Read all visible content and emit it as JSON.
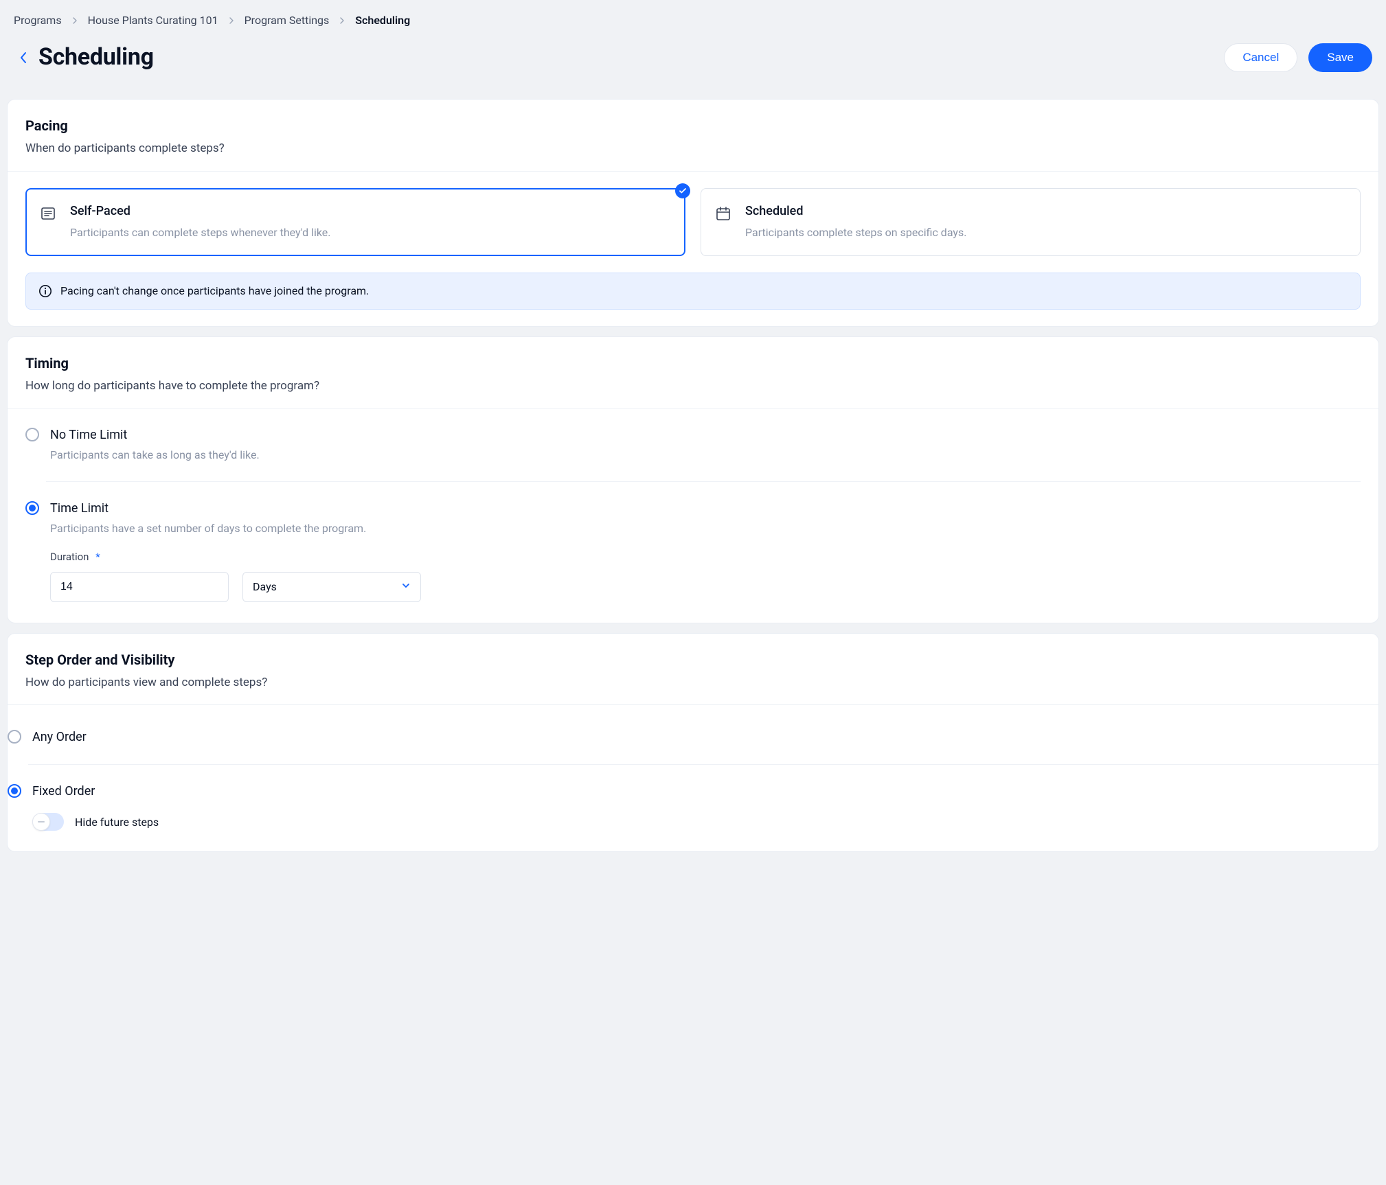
{
  "breadcrumbs": {
    "items": [
      {
        "label": "Programs"
      },
      {
        "label": "House Plants Curating 101"
      },
      {
        "label": "Program Settings"
      },
      {
        "label": "Scheduling"
      }
    ]
  },
  "header": {
    "title": "Scheduling",
    "cancel": "Cancel",
    "save": "Save"
  },
  "pacing": {
    "title": "Pacing",
    "subtitle": "When do participants complete steps?",
    "selected": "self_paced",
    "options": {
      "self_paced": {
        "title": "Self-Paced",
        "desc": "Participants can complete steps whenever they'd like."
      },
      "scheduled": {
        "title": "Scheduled",
        "desc": "Participants complete steps on specific days."
      }
    },
    "info": "Pacing can't change once participants have joined the program."
  },
  "timing": {
    "title": "Timing",
    "subtitle": "How long do participants have to complete the program?",
    "selected": "time_limit",
    "no_limit": {
      "title": "No Time Limit",
      "desc": "Participants can take as long as they'd like."
    },
    "time_limit": {
      "title": "Time Limit",
      "desc": "Participants have a set number of days to complete the program.",
      "duration_label": "Duration",
      "required_mark": "*",
      "duration_value": "14",
      "unit_selected": "Days"
    }
  },
  "step_order": {
    "title": "Step Order and Visibility",
    "subtitle": "How do participants view and complete steps?",
    "selected": "fixed",
    "any": {
      "title": "Any Order"
    },
    "fixed": {
      "title": "Fixed Order",
      "hide_future_label": "Hide future steps",
      "hide_future_on": false
    }
  }
}
